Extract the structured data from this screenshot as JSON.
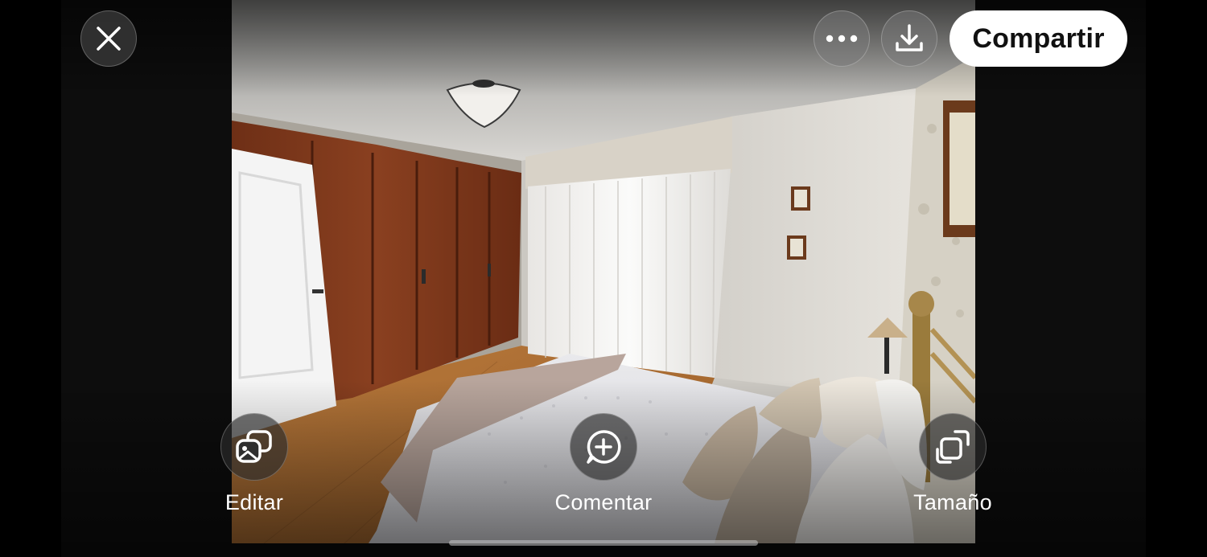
{
  "viewer": {
    "share_label": "Compartir"
  },
  "actions": {
    "edit_label": "Editar",
    "comment_label": "Comentar",
    "size_label": "Tamaño"
  },
  "icons": {
    "close": "close-icon",
    "more": "more-horizontal-icon",
    "download": "download-icon",
    "edit": "edit-photo-icon",
    "comment": "add-comment-icon",
    "size": "resize-icon"
  },
  "colors": {
    "share_bg": "#ffffff",
    "share_text": "#111111",
    "overlay_button": "#3c3c3c"
  }
}
